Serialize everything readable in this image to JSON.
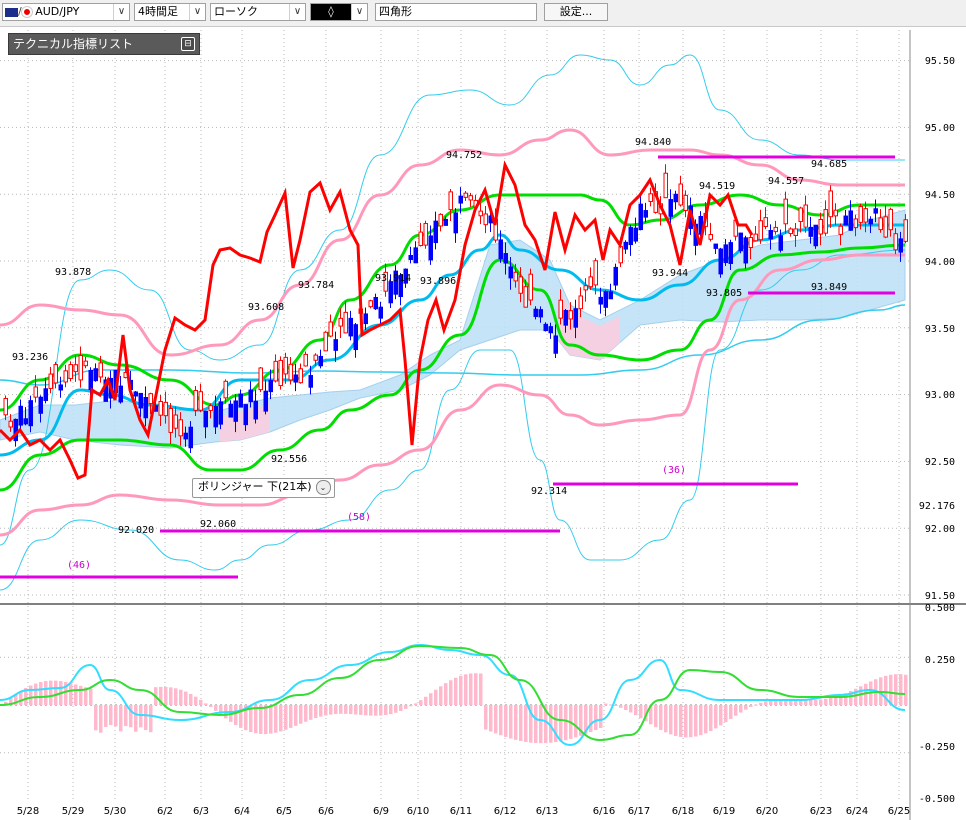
{
  "toolbar": {
    "symbol": "AUD/JPY",
    "timeframe": "4時間足",
    "chart_type": "ローソク",
    "drawing_symbol": "◊",
    "drawing_tool": "四角形",
    "settings_button": "設定..."
  },
  "indicator_panel": {
    "title": "テクニカル指標リスト",
    "collapse_icon": "⊟"
  },
  "tooltip": {
    "text": "ボリンジャー 下(21本)",
    "icon": "⌄"
  },
  "colors": {
    "up": "#ff0000",
    "down": "#0000ff",
    "red_line": "#ff0000",
    "green_band": "#00dd00",
    "pink_band": "#ff99bb",
    "cyan_band": "#33ccee",
    "sky_ma": "#00bbee",
    "magenta_hline": "#e000e0",
    "cloud_blue": "#bfe2f7",
    "cloud_pink": "#f8cfe0",
    "macd_line": "#33ddff",
    "signal_line": "#33dd33",
    "histogram": "#ffb8cc"
  },
  "chart_data": {
    "type": "candlestick",
    "y_ticks": [
      "95.50",
      "95.00",
      "94.50",
      "94.00",
      "93.50",
      "93.00",
      "92.50",
      "92.176",
      "92.00",
      "91.50"
    ],
    "oscillator_ticks": [
      "0.500",
      "0.250",
      "-0.250",
      "-0.500"
    ],
    "x_ticks": [
      "5/28",
      "5/29",
      "5/30",
      "6/2",
      "6/3",
      "6/4",
      "6/5",
      "6/6",
      "6/9",
      "6/10",
      "6/11",
      "6/12",
      "6/13",
      "6/16",
      "6/17",
      "6/18",
      "6/19",
      "6/20",
      "6/23",
      "6/24",
      "6/25"
    ],
    "price_labels": [
      "93.236",
      "93.878",
      "92.020",
      "92.060",
      "93.608",
      "92.556",
      "93.784",
      "93.914",
      "93.896",
      "94.752",
      "92.314",
      "94.840",
      "93.944",
      "94.519",
      "93.805",
      "94.557",
      "94.685",
      "93.849"
    ],
    "count_labels": [
      "(46)",
      "(58)",
      "(36)"
    ]
  }
}
